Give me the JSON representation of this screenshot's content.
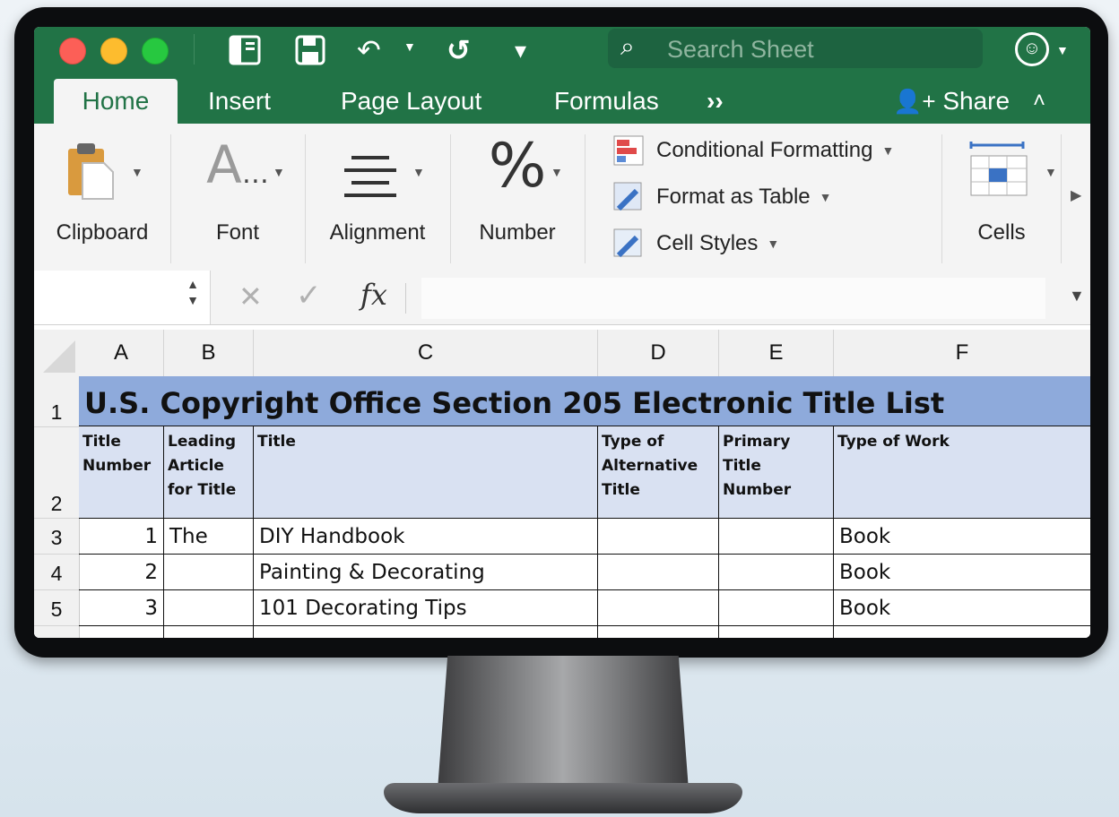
{
  "toolbar": {
    "search_placeholder": "Search Sheet"
  },
  "tabs": [
    {
      "label": "Home",
      "active": true
    },
    {
      "label": "Insert"
    },
    {
      "label": "Page Layout"
    },
    {
      "label": "Formulas"
    },
    {
      "label": "››"
    }
  ],
  "share": {
    "label": "Share"
  },
  "ribbon": {
    "clipboard": "Clipboard",
    "font": "Font",
    "alignment": "Alignment",
    "number": "Number",
    "conditional_formatting": "Conditional Formatting",
    "format_as_table": "Format as Table",
    "cell_styles": "Cell Styles",
    "cells": "Cells"
  },
  "formula_bar": {
    "fx": "fx",
    "cancel": "✕",
    "enter": "✓"
  },
  "columns": [
    "A",
    "B",
    "C",
    "D",
    "E",
    "F"
  ],
  "rows": [
    "1",
    "2",
    "3",
    "4",
    "5"
  ],
  "sheet": {
    "title": "U.S. Copyright Office Section 205 Electronic Title List",
    "headers": {
      "a": "Title Number",
      "b": "Leading Article for Title",
      "c": "Title",
      "d": "Type of Alternative Title",
      "e": "Primary Title Number",
      "f": "Type of Work"
    },
    "data": [
      {
        "a": "1",
        "b": "The",
        "c": "DIY Handbook",
        "d": "",
        "e": "",
        "f": "Book"
      },
      {
        "a": "2",
        "b": "",
        "c": "Painting & Decorating",
        "d": "",
        "e": "",
        "f": "Book"
      },
      {
        "a": "3",
        "b": "",
        "c": "101 Decorating Tips",
        "d": "",
        "e": "",
        "f": "Book"
      }
    ]
  },
  "colors": {
    "excel_green": "#217346",
    "title_fill": "#8eaadb",
    "header_fill": "#d9e1f2"
  }
}
